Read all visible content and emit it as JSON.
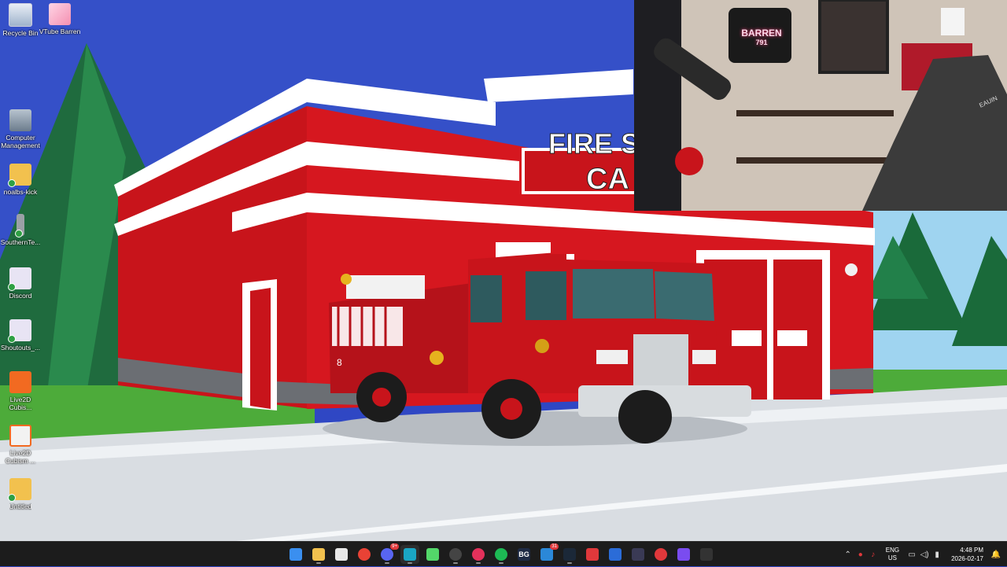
{
  "desktop_icons": [
    {
      "label": "Recycle Bin",
      "icon": "recycle-bin-icon"
    },
    {
      "label": "VTube Barren",
      "icon": "vtube-icon"
    },
    {
      "label": "Computer Management",
      "icon": "computer-management-icon"
    },
    {
      "label": "noalbs-kick",
      "icon": "folder-icon"
    },
    {
      "label": "SouthernTe...",
      "icon": "app-icon"
    },
    {
      "label": "Discord",
      "icon": "file-icon"
    },
    {
      "label": "Shoutouts_...",
      "icon": "file-icon"
    },
    {
      "label": "Live2D Cubis...",
      "icon": "live2d-icon"
    },
    {
      "label": "Live2D Cubism ...",
      "icon": "live2d-icon"
    },
    {
      "label": "Untitled",
      "icon": "folder-icon"
    }
  ],
  "wallpaper": {
    "sign_line1": "FIRE S",
    "sign_line2": "CA",
    "emblem_text": "8",
    "door_number": "8",
    "truck_plate": "8"
  },
  "webcam": {
    "neon_sign": "BARREN",
    "neon_sub": "791",
    "chair_brand": "EAUIN"
  },
  "taskbar": {
    "apps": [
      {
        "name": "start",
        "icon": "windows-start-icon",
        "glyph": "",
        "color": "#3a8ff0"
      },
      {
        "name": "file-explorer",
        "icon": "folder-icon",
        "glyph": "",
        "color": "#f2c14e"
      },
      {
        "name": "store",
        "icon": "store-icon",
        "glyph": "",
        "color": "#e8e8e8"
      },
      {
        "name": "chrome",
        "icon": "chrome-icon",
        "glyph": "",
        "color": "#e94235"
      },
      {
        "name": "discord",
        "icon": "discord-icon",
        "glyph": "",
        "color": "#5865f2",
        "badge": "9+"
      },
      {
        "name": "edge",
        "icon": "edge-icon",
        "glyph": "",
        "color": "#1aa6c4"
      },
      {
        "name": "streamer-app",
        "icon": "streamer-icon",
        "glyph": "",
        "color": "#53d769"
      },
      {
        "name": "obs",
        "icon": "obs-icon",
        "glyph": "",
        "color": "#444444"
      },
      {
        "name": "streamlabs",
        "icon": "streamlabs-icon",
        "glyph": "",
        "color": "#e3315b"
      },
      {
        "name": "spotify",
        "icon": "spotify-icon",
        "glyph": "",
        "color": "#1db954"
      },
      {
        "name": "bg",
        "icon": "bg-icon",
        "glyph": "BG",
        "color": "#1e2a44"
      },
      {
        "name": "notes",
        "icon": "notes-icon",
        "glyph": "",
        "color": "#2b88d8",
        "badge": "31"
      },
      {
        "name": "steam",
        "icon": "steam-icon",
        "glyph": "",
        "color": "#1b2838"
      },
      {
        "name": "maps",
        "icon": "location-icon",
        "glyph": "",
        "color": "#e0383b"
      },
      {
        "name": "defender",
        "icon": "shield-icon",
        "glyph": "",
        "color": "#2b6cd8"
      },
      {
        "name": "arrow-app",
        "icon": "arrow-icon",
        "glyph": "",
        "color": "#3a3a55"
      },
      {
        "name": "record",
        "icon": "record-icon",
        "glyph": "",
        "color": "#e0383b"
      },
      {
        "name": "grid-app",
        "icon": "grid-icon",
        "glyph": "",
        "color": "#7a4cf0"
      },
      {
        "name": "game-app",
        "icon": "game-icon",
        "glyph": "",
        "color": "#333333"
      }
    ],
    "tray": {
      "lang_top": "ENG",
      "lang_bottom": "US",
      "time": "4:48 PM",
      "date": "2026-02-17"
    }
  }
}
